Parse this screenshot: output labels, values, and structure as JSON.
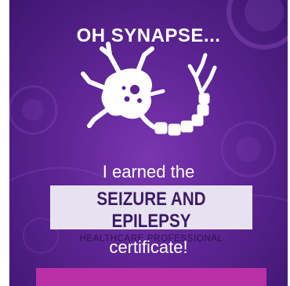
{
  "card": {
    "headline": "OH SYNAPSE...",
    "earned_text": "I earned the",
    "badge": {
      "title": "SEIZURE AND EPILEPSY",
      "subtitle": "HEALTHCARE PROFESSIONAL"
    },
    "certificate_text": "certificate!"
  },
  "icons": {
    "neuron": "neuron-icon"
  },
  "colors": {
    "background": "#5e2594",
    "badge_bg": "#e8e2f0",
    "badge_text": "#3b1a66",
    "accent_bar": "#b92fa6"
  }
}
